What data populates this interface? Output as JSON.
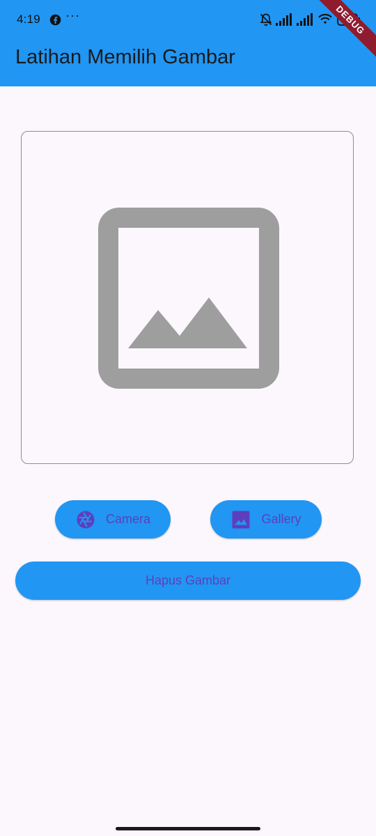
{
  "status_bar": {
    "time": "4:19",
    "notification_dots": "···",
    "battery_level": "65"
  },
  "debug_banner": "DEBUG",
  "app_bar": {
    "title": "Latihan Memilih Gambar",
    "color": "#2196f3"
  },
  "image_area": {
    "icon": "image-placeholder-icon"
  },
  "buttons": {
    "camera_label": "Camera",
    "camera_icon": "camera-shutter-icon",
    "gallery_label": "Gallery",
    "gallery_icon": "image-icon",
    "delete_label": "Hapus Gambar"
  },
  "colors": {
    "accent": "#2196f3",
    "button_text": "#5d3fbd",
    "background": "#fcf7fd",
    "placeholder_gray": "#9e9e9e"
  }
}
